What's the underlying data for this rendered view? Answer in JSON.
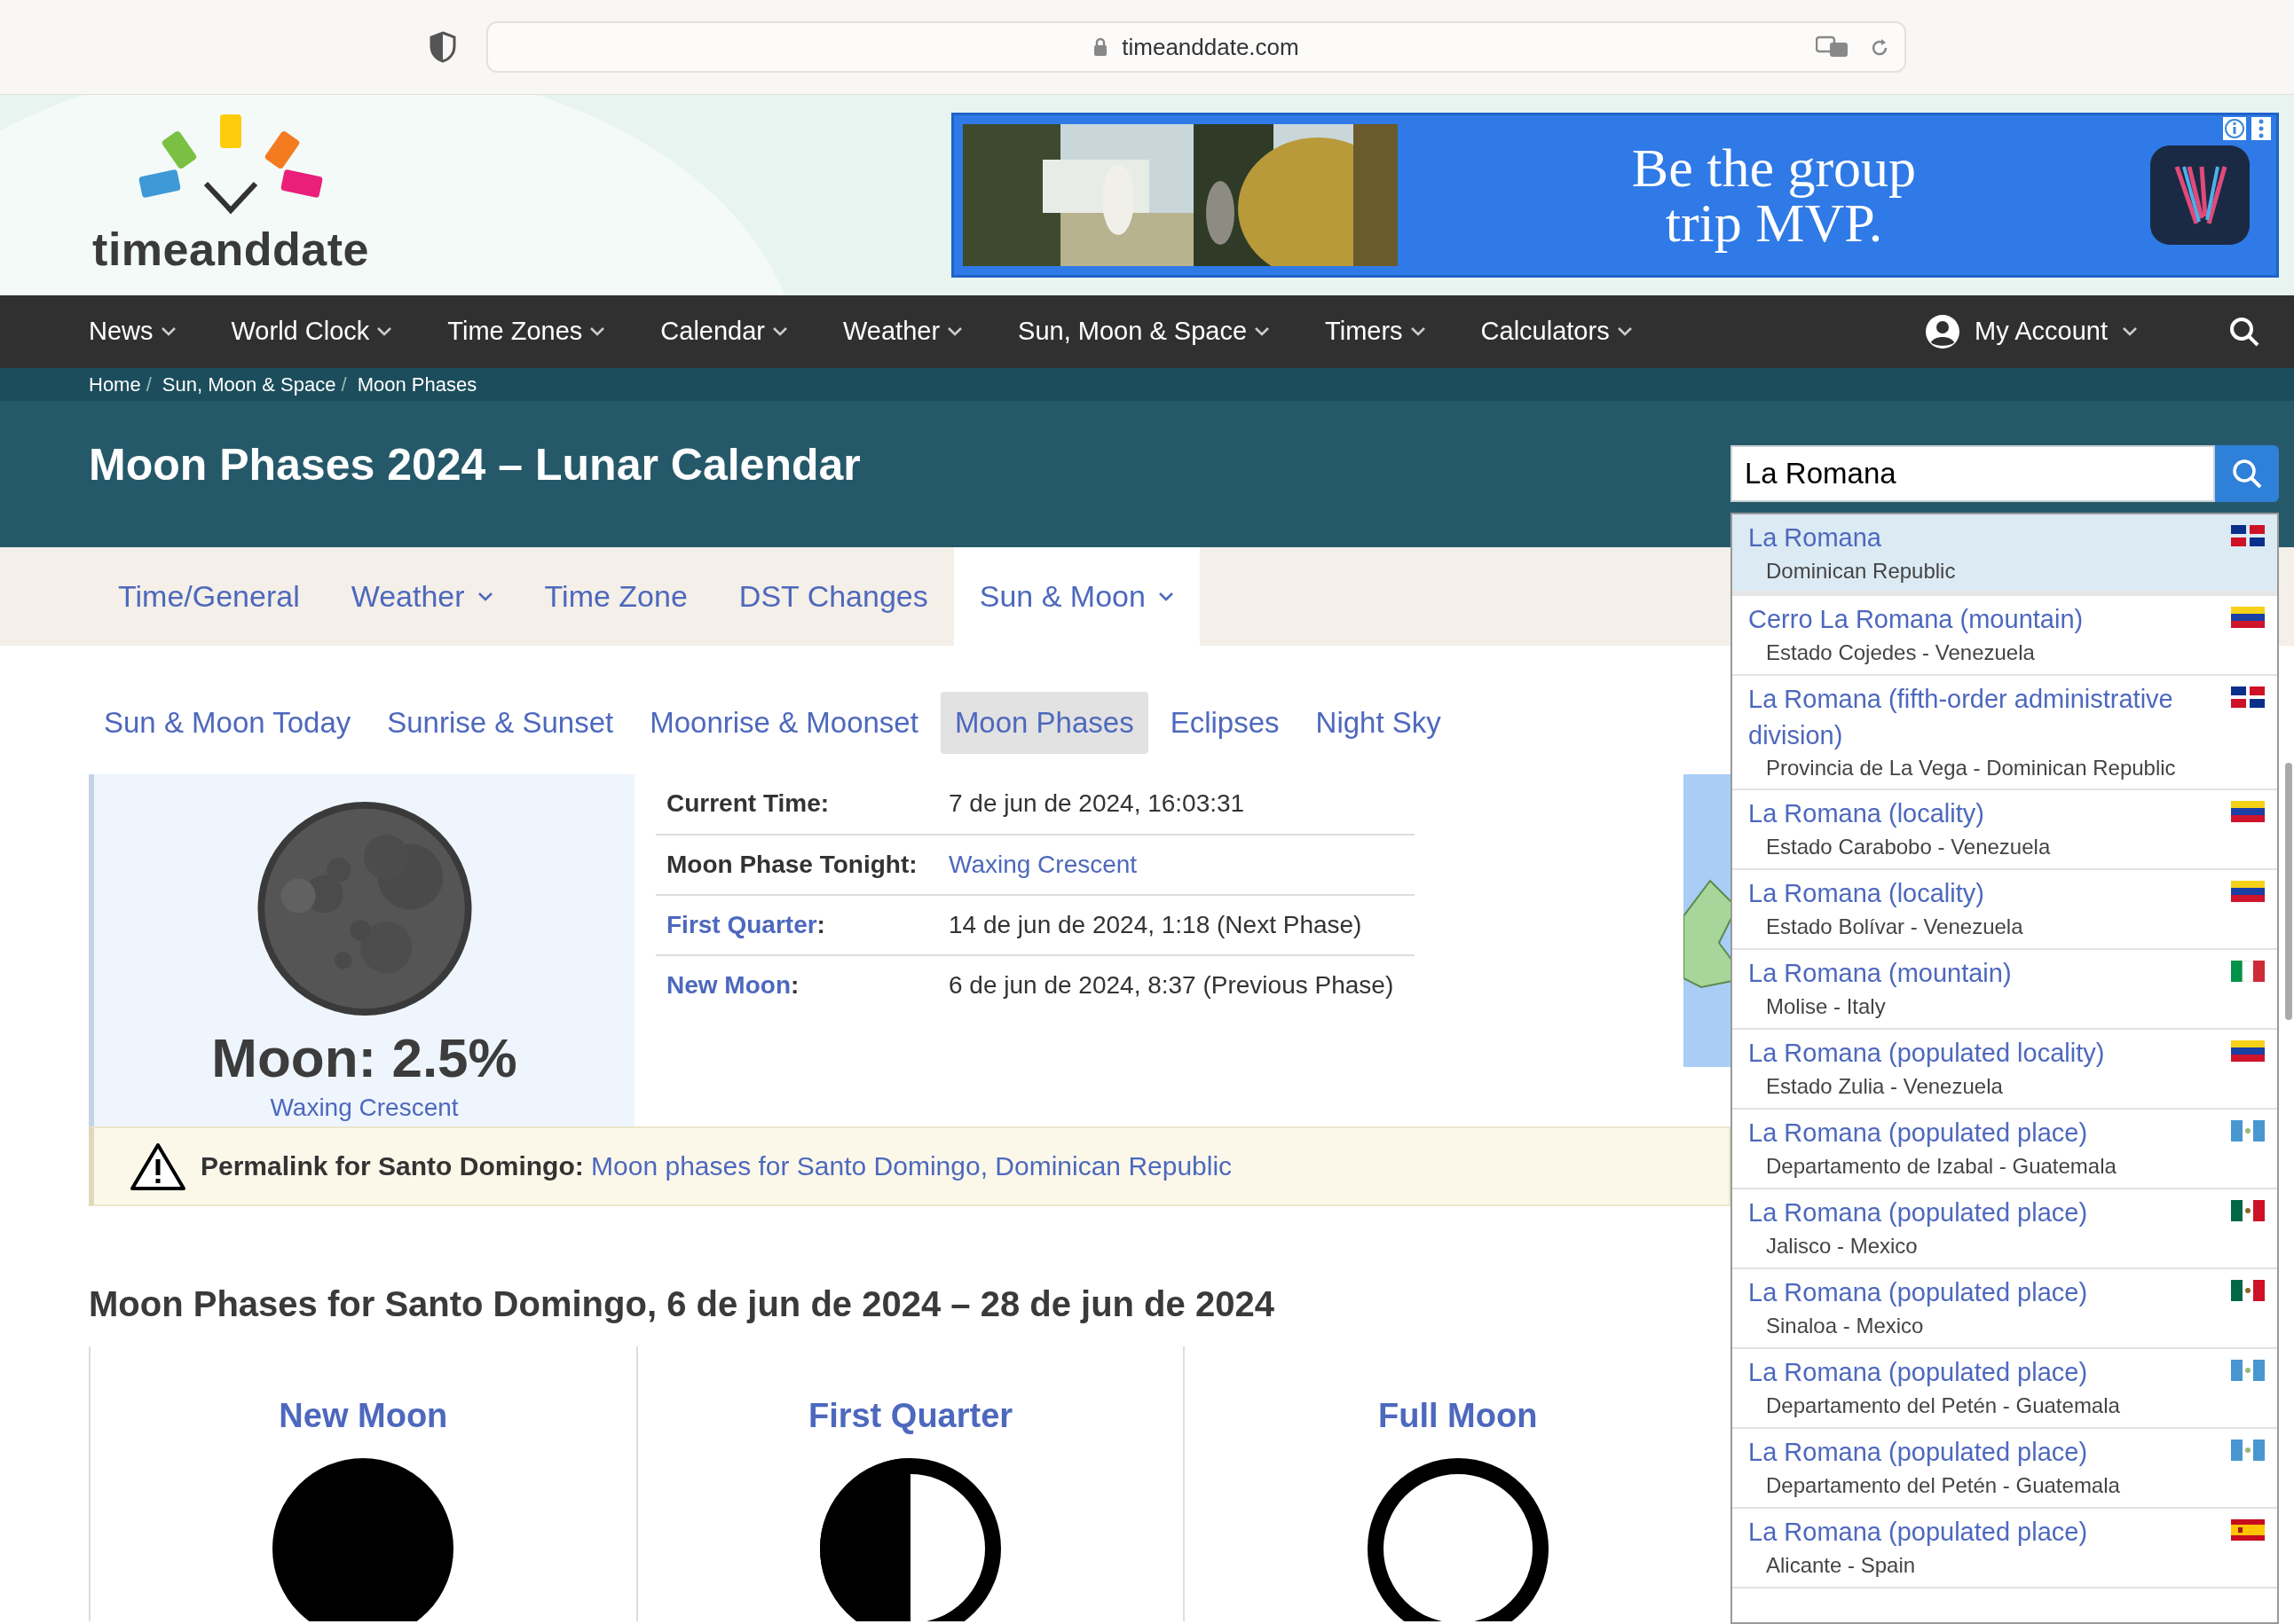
{
  "browser": {
    "url": "timeanddate.com"
  },
  "logo": {
    "text": "timeanddate"
  },
  "ad": {
    "headline": "Be the group trip MVP."
  },
  "nav": {
    "items": [
      {
        "label": "News",
        "dropdown": true
      },
      {
        "label": "World Clock",
        "dropdown": true
      },
      {
        "label": "Time Zones",
        "dropdown": true
      },
      {
        "label": "Calendar",
        "dropdown": true
      },
      {
        "label": "Weather",
        "dropdown": true
      },
      {
        "label": "Sun, Moon & Space",
        "dropdown": true
      },
      {
        "label": "Timers",
        "dropdown": true
      },
      {
        "label": "Calculators",
        "dropdown": true
      }
    ],
    "account": {
      "label": "My Account",
      "dropdown": true
    }
  },
  "breadcrumb": [
    {
      "label": "Home",
      "separator": "/"
    },
    {
      "label": "Sun, Moon & Space",
      "separator": "/"
    },
    {
      "label": "Moon Phases"
    }
  ],
  "title": "Moon Phases 2024 – Lunar Calendar",
  "search": {
    "value": "La Romana"
  },
  "search_results": [
    {
      "name": "La Romana",
      "place": "Dominican Republic",
      "kind": "do",
      "selected": true
    },
    {
      "name": "Cerro La Romana (mountain)",
      "place": "Estado Cojedes - Venezuela",
      "kind": "ve",
      "selected": false
    },
    {
      "name": "La Romana (fifth-order administrative division)",
      "place": "Provincia de La Vega - Dominican Republic",
      "kind": "do",
      "selected": false
    },
    {
      "name": "La Romana (locality)",
      "place": "Estado Carabobo - Venezuela",
      "kind": "ve",
      "selected": false
    },
    {
      "name": "La Romana (locality)",
      "place": "Estado Bolívar - Venezuela",
      "kind": "ve",
      "selected": false
    },
    {
      "name": "La Romana (mountain)",
      "place": "Molise - Italy",
      "kind": "it",
      "selected": false
    },
    {
      "name": "La Romana (populated locality)",
      "place": "Estado Zulia - Venezuela",
      "kind": "ve",
      "selected": false
    },
    {
      "name": "La Romana (populated place)",
      "place": "Departamento de Izabal - Guatemala",
      "kind": "gt",
      "selected": false
    },
    {
      "name": "La Romana (populated place)",
      "place": "Jalisco - Mexico",
      "kind": "mx",
      "selected": false
    },
    {
      "name": "La Romana (populated place)",
      "place": "Sinaloa - Mexico",
      "kind": "mx",
      "selected": false
    },
    {
      "name": "La Romana (populated place)",
      "place": "Departamento del Petén - Guatemala",
      "kind": "gt",
      "selected": false
    },
    {
      "name": "La Romana (populated place)",
      "place": "Departamento del Petén - Guatemala",
      "kind": "gt",
      "selected": false
    },
    {
      "name": "La Romana (populated place)",
      "place": "Alicante - Spain",
      "kind": "es",
      "selected": false
    }
  ],
  "tabs": [
    {
      "label": "Time/General",
      "dropdown": false,
      "selected": false
    },
    {
      "label": "Weather",
      "dropdown": true,
      "selected": false
    },
    {
      "label": "Time Zone",
      "dropdown": false,
      "selected": false
    },
    {
      "label": "DST Changes",
      "dropdown": false,
      "selected": false
    },
    {
      "label": "Sun & Moon",
      "dropdown": true,
      "selected": true
    }
  ],
  "subnav": [
    {
      "label": "Sun & Moon Today",
      "selected": false
    },
    {
      "label": "Sunrise & Sunset",
      "selected": false
    },
    {
      "label": "Moonrise & Moonset",
      "selected": false
    },
    {
      "label": "Moon Phases",
      "selected": true
    },
    {
      "label": "Eclipses",
      "selected": false
    },
    {
      "label": "Night Sky",
      "selected": false
    }
  ],
  "moon": {
    "illumination": "Moon: 2.5%",
    "phase": "Waxing Crescent"
  },
  "info": [
    {
      "label": "Current Time:",
      "value": "7 de jun de 2024, 16:03:31",
      "kind": "text"
    },
    {
      "label": "Moon Phase Tonight:",
      "value": "Waxing Crescent",
      "kind": "value-link"
    },
    {
      "label": "First Quarter",
      "suffix": ":",
      "value": "14 de jun de 2024, 1:18 (Next Phase)",
      "kind": "label-link"
    },
    {
      "label": "New Moon",
      "suffix": ":",
      "value": "6 de jun de 2024, 8:37 (Previous Phase)",
      "kind": "label-link"
    }
  ],
  "permalink": {
    "label": "Permalink for Santo Domingo:",
    "link": "Moon phases for Santo Domingo, Dominican Republic"
  },
  "phases_heading": "Moon Phases for Santo Domingo, 6 de jun de 2024 – 28 de jun de 2024",
  "phases": [
    {
      "name": "New Moon",
      "kind": "new"
    },
    {
      "name": "First Quarter",
      "kind": "first-quarter"
    },
    {
      "name": "Full Moon",
      "kind": "full"
    }
  ]
}
